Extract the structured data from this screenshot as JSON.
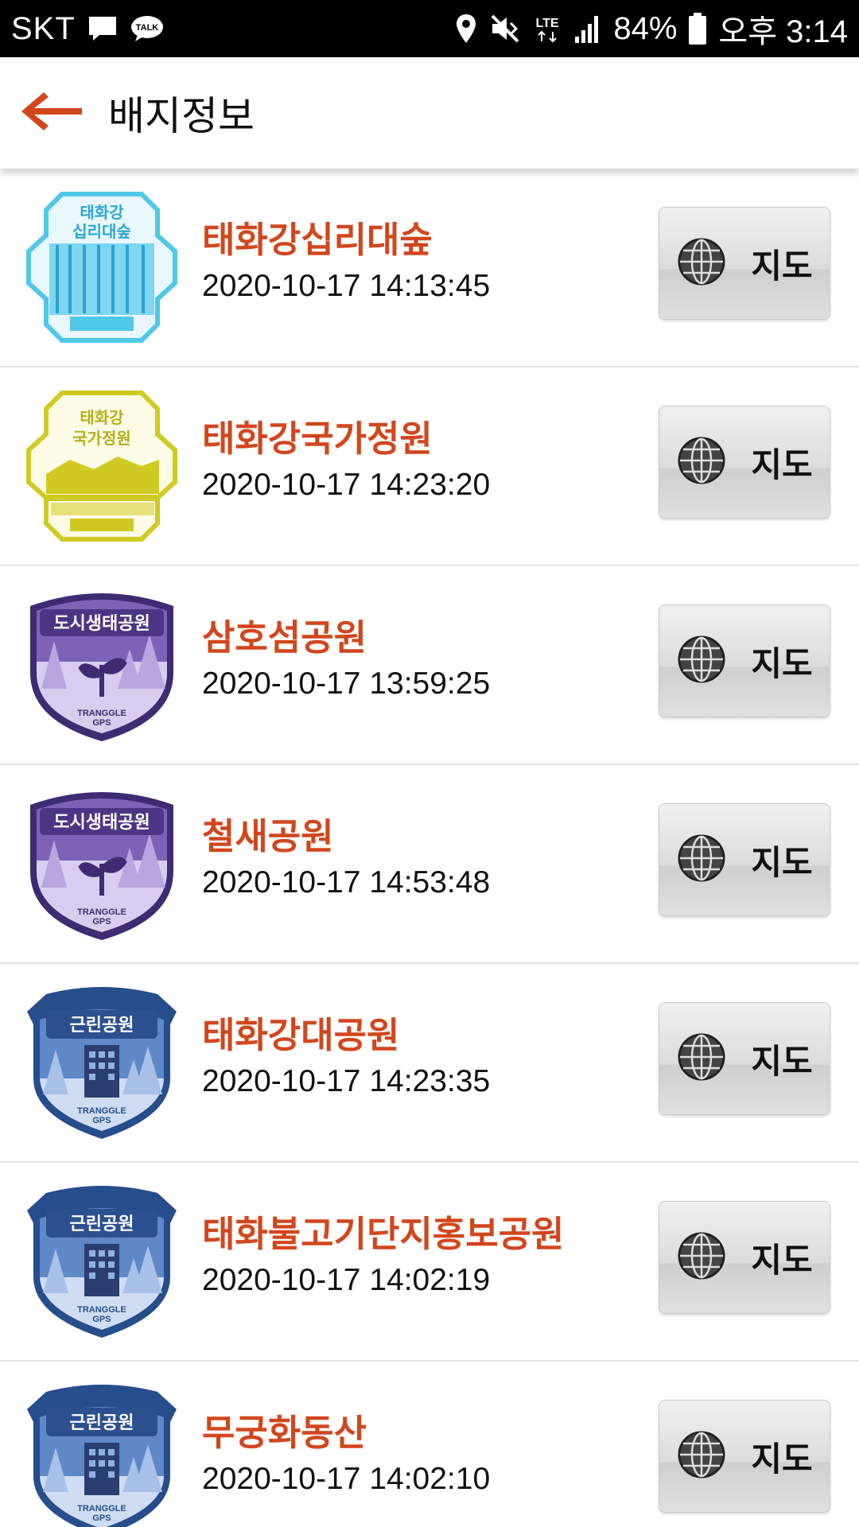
{
  "status_bar": {
    "carrier": "SKT",
    "battery": "84%",
    "time": "오후 3:14",
    "network": "LTE",
    "icons": [
      "message-icon",
      "talk-icon",
      "location-icon",
      "mute-icon",
      "lte-icon",
      "signal-icon",
      "battery-icon"
    ]
  },
  "header": {
    "title": "배지정보",
    "back_icon": "back-arrow-icon"
  },
  "colors": {
    "accent": "#d2461c",
    "status_bar_bg": "#000000",
    "cyan_badge": "#4fc8ea",
    "yellow_badge": "#cfcb22",
    "purple_badge": "#6a4fa3",
    "blue_badge": "#3f6fb5"
  },
  "badges": [
    {
      "name": "태화강십리대숲",
      "date": "2020-10-17 14:13:45",
      "map_label": "지도",
      "badge_style": "cyan-stamp",
      "badge_text": [
        "태화강",
        "십리대숲"
      ]
    },
    {
      "name": "태화강국가정원",
      "date": "2020-10-17 14:23:20",
      "map_label": "지도",
      "badge_style": "yellow-stamp",
      "badge_text": [
        "태화강",
        "국가정원"
      ]
    },
    {
      "name": "삼호섬공원",
      "date": "2020-10-17 13:59:25",
      "map_label": "지도",
      "badge_style": "purple-shield",
      "badge_text": [
        "도시생태공원",
        "TRANGGLE",
        "GPS"
      ]
    },
    {
      "name": "철새공원",
      "date": "2020-10-17 14:53:48",
      "map_label": "지도",
      "badge_style": "purple-shield",
      "badge_text": [
        "도시생태공원",
        "TRANGGLE",
        "GPS"
      ]
    },
    {
      "name": "태화강대공원",
      "date": "2020-10-17 14:23:35",
      "map_label": "지도",
      "badge_style": "blue-shield",
      "badge_text": [
        "근린공원",
        "TRANGGLE",
        "GPS"
      ]
    },
    {
      "name": "태화불고기단지홍보공원",
      "date": "2020-10-17 14:02:19",
      "map_label": "지도",
      "badge_style": "blue-shield",
      "badge_text": [
        "근린공원",
        "TRANGGLE",
        "GPS"
      ]
    },
    {
      "name": "무궁화동산",
      "date": "2020-10-17 14:02:10",
      "map_label": "지도",
      "badge_style": "blue-shield",
      "badge_text": [
        "근린공원",
        "TRANGGLE",
        "GPS"
      ]
    }
  ]
}
